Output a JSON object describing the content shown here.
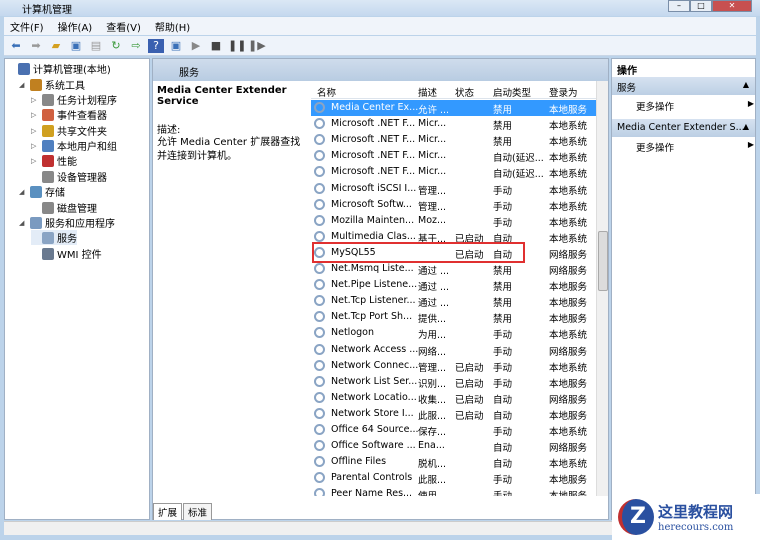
{
  "window": {
    "title": "计算机管理",
    "controls": [
      "–",
      "□",
      "✕"
    ]
  },
  "menu": [
    "文件(F)",
    "操作(A)",
    "查看(V)",
    "帮助(H)"
  ],
  "tree": [
    {
      "label": "计算机管理(本地)",
      "level": 0,
      "exp": ""
    },
    {
      "label": "系统工具",
      "level": 1,
      "exp": "◢"
    },
    {
      "label": "任务计划程序",
      "level": 2,
      "exp": "▷"
    },
    {
      "label": "事件查看器",
      "level": 2,
      "exp": "▷"
    },
    {
      "label": "共享文件夹",
      "level": 2,
      "exp": "▷"
    },
    {
      "label": "本地用户和组",
      "level": 2,
      "exp": "▷"
    },
    {
      "label": "性能",
      "level": 2,
      "exp": "▷"
    },
    {
      "label": "设备管理器",
      "level": 2,
      "exp": ""
    },
    {
      "label": "存储",
      "level": 1,
      "exp": "◢"
    },
    {
      "label": "磁盘管理",
      "level": 2,
      "exp": ""
    },
    {
      "label": "服务和应用程序",
      "level": 1,
      "exp": "◢"
    },
    {
      "label": "服务",
      "level": 2,
      "exp": ""
    },
    {
      "label": "WMI 控件",
      "level": 2,
      "exp": ""
    }
  ],
  "center": {
    "header": "服务",
    "service_name": "Media Center Extender Service",
    "desc_label": "描述:",
    "desc_text": "允许 Media Center 扩展器查找并连接到计算机。"
  },
  "columns": [
    "名称",
    "描述",
    "状态",
    "启动类型",
    "登录为"
  ],
  "services": [
    [
      "Media Center Ex...",
      "允许 ...",
      "",
      "禁用",
      "本地服务"
    ],
    [
      "Microsoft .NET F...",
      "Micr...",
      "",
      "禁用",
      "本地系统"
    ],
    [
      "Microsoft .NET F...",
      "Micr...",
      "",
      "禁用",
      "本地系统"
    ],
    [
      "Microsoft .NET F...",
      "Micr...",
      "",
      "自动(延迟...",
      "本地系统"
    ],
    [
      "Microsoft .NET F...",
      "Micr...",
      "",
      "自动(延迟...",
      "本地系统"
    ],
    [
      "Microsoft iSCSI I...",
      "管理...",
      "",
      "手动",
      "本地系统"
    ],
    [
      "Microsoft Softw...",
      "管理...",
      "",
      "手动",
      "本地系统"
    ],
    [
      "Mozilla Mainten...",
      "Moz...",
      "",
      "手动",
      "本地系统"
    ],
    [
      "Multimedia Clas...",
      "基于...",
      "已启动",
      "自动",
      "本地系统"
    ],
    [
      "MySQL55",
      "",
      "已启动",
      "自动",
      "网络服务"
    ],
    [
      "Net.Msmq Liste...",
      "通过 ...",
      "",
      "禁用",
      "网络服务"
    ],
    [
      "Net.Pipe Listene...",
      "通过 ...",
      "",
      "禁用",
      "本地服务"
    ],
    [
      "Net.Tcp Listener...",
      "通过 ...",
      "",
      "禁用",
      "本地服务"
    ],
    [
      "Net.Tcp Port Sh...",
      "提供...",
      "",
      "禁用",
      "本地服务"
    ],
    [
      "Netlogon",
      "为用...",
      "",
      "手动",
      "本地系统"
    ],
    [
      "Network Access ...",
      "网络...",
      "",
      "手动",
      "网络服务"
    ],
    [
      "Network Connec...",
      "管理...",
      "已启动",
      "手动",
      "本地系统"
    ],
    [
      "Network List Ser...",
      "识别...",
      "已启动",
      "手动",
      "本地服务"
    ],
    [
      "Network Locatio...",
      "收集...",
      "已启动",
      "自动",
      "网络服务"
    ],
    [
      "Network Store I...",
      "此服...",
      "已启动",
      "自动",
      "本地服务"
    ],
    [
      "Office 64 Source...",
      "保存...",
      "",
      "手动",
      "本地系统"
    ],
    [
      "Office Software ...",
      "Ena...",
      "",
      "自动",
      "网络服务"
    ],
    [
      "Offline Files",
      "脱机...",
      "",
      "自动",
      "本地系统"
    ],
    [
      "Parental Controls",
      "此服...",
      "",
      "手动",
      "本地服务"
    ],
    [
      "Peer Name Res...",
      "使用...",
      "",
      "手动",
      "本地服务"
    ]
  ],
  "tabs": [
    "扩展",
    "标准"
  ],
  "actions": {
    "title": "操作",
    "sections": [
      {
        "header": "服务",
        "item": "更多操作"
      },
      {
        "header": "Media Center Extender S...",
        "item": "更多操作"
      }
    ]
  },
  "watermark": {
    "name": "这里教程网",
    "url": "herecours.com"
  }
}
